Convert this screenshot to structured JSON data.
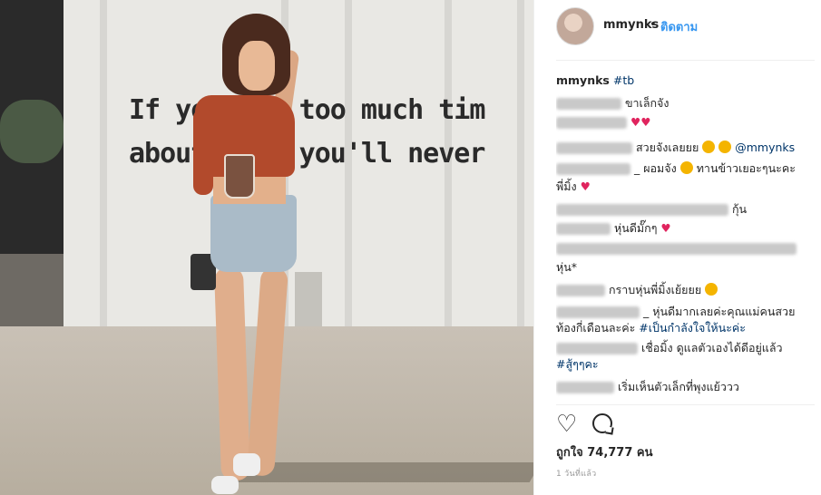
{
  "post": {
    "username": "mmynks",
    "separator": "•",
    "follow_label": "ติดตาม",
    "photo_wall_line1": "If you had too much tim",
    "photo_wall_line2": "about ing, you'll never",
    "caption_user": "mmynks",
    "caption_tag": "#tb",
    "likes_text": "ถูกใจ 74,777 คน",
    "timestamp": "1 วันที่แล้ว"
  },
  "comments": [
    {
      "text": "ขาเล็กจัง"
    },
    {
      "text": "♥♥"
    },
    {
      "text": "สวยจังเลยยย",
      "mention": "@mmynks"
    },
    {
      "text": "_ ผอมจัง",
      "text2": "ทานข้าวเยอะๆนะคะ"
    },
    {
      "text": "พี่มิ้ง"
    },
    {
      "text": "กุ้น"
    },
    {
      "text": "หุ่นดีมั๊กๆ"
    },
    {
      "text": "หุ่น*"
    },
    {
      "text": "กราบหุ่นพี่มิ้งเย้ยยย"
    },
    {
      "text": "_ หุ่นดีมากเลยค่ะคุณแม่คนสวย"
    },
    {
      "text": "ท้องกี่เดือนละค่ะ",
      "tag": "#เป็นกำลังใจให้นะค่ะ"
    },
    {
      "text": "เชื่อมิ้ง ดูแลตัวเองได้ดีอยู่แล้ว"
    },
    {
      "tag": "#สู้ๆๆคะ"
    },
    {
      "text": "เริ่มเห็นตัวเล็กที่พุงแย้ววว"
    }
  ],
  "colors": {
    "accent": "#3897f0",
    "heart": "#e0245e",
    "tag": "#003569"
  },
  "icons": {
    "like": "heart-outline-icon",
    "comment": "comment-bubble-icon"
  }
}
